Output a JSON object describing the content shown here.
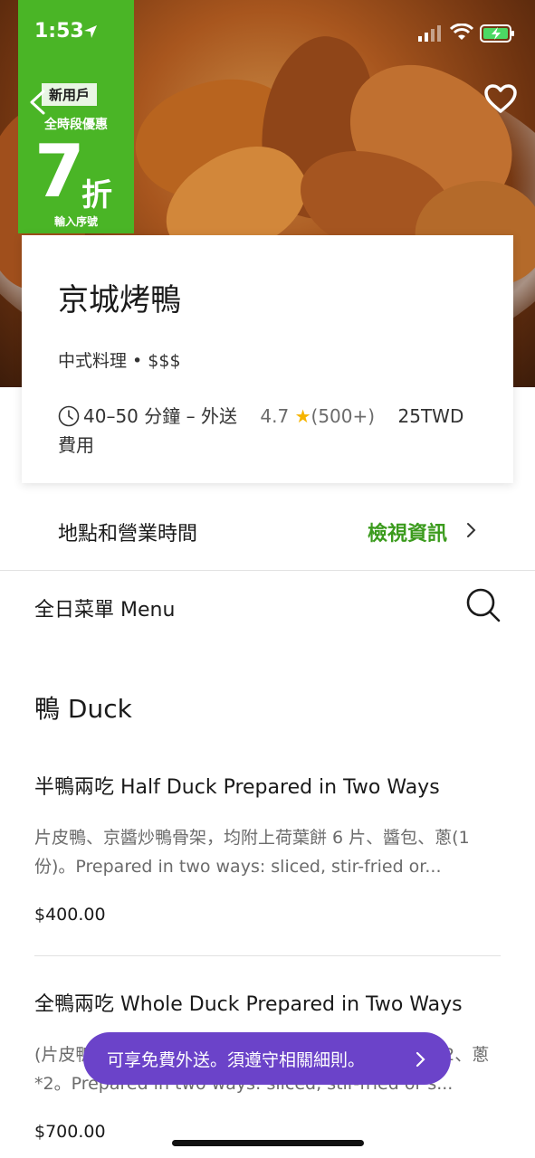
{
  "status_bar": {
    "time": "1:53"
  },
  "promo": {
    "badge": "新用戶",
    "subtitle": "全時段優惠",
    "discount_number": "7",
    "discount_unit": "折",
    "note": "輸入序號"
  },
  "restaurant": {
    "name": "京城烤鴨",
    "cuisine": "中式料理 • $$$",
    "eta": "40–50 分鐘 – 外送",
    "rating": "4.7",
    "rating_count": "(500+)",
    "fee_amount": "25TWD",
    "fee_label": "費用"
  },
  "info_row": {
    "label": "地點和營業時間",
    "link": "檢視資訊"
  },
  "menu": {
    "title": "全日菜單 Menu"
  },
  "section": {
    "title": "鴨 Duck"
  },
  "items": [
    {
      "name": "半鴨兩吃 Half Duck Prepared in Two Ways",
      "description": "片皮鴨、京醬炒鴨骨架，均附上荷葉餅 6 片、醬包、蔥(1份)。Prepared in two ways: sliced, stir-fried or...",
      "price": "$400.00"
    },
    {
      "name": "全鴨兩吃 Whole Duck Prepared in Two Ways",
      "description": "(片皮鴨、京醬炒鴨骨架，均附上荷葉餅 12 片、醬包*2、蔥*2。Prepared in two ways: sliced, stir-fried or s...",
      "price": "$700.00"
    }
  ],
  "toast": {
    "text": "可享免費外送。須遵守相關細則。"
  },
  "colors": {
    "promo_green": "#4ab526",
    "link_green": "#3b9b1d",
    "toast_purple": "#6b43c9",
    "star": "#f6b400"
  }
}
